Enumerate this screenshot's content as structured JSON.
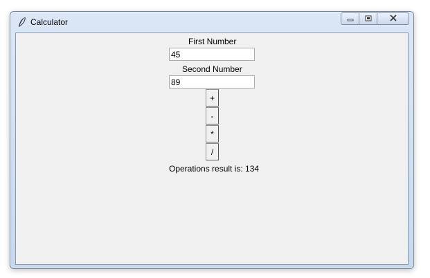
{
  "window": {
    "title": "Calculator"
  },
  "form": {
    "first_label": "First Number",
    "first_value": "45",
    "second_label": "Second Number",
    "second_value": "89"
  },
  "buttons": {
    "add": "+",
    "subtract": "-",
    "multiply": "*",
    "divide": "/"
  },
  "result": {
    "text": "Operations result is: 134"
  },
  "icons": {
    "app": "feather-icon",
    "minimize": "minimize-icon",
    "maximize": "maximize-icon",
    "close": "close-icon"
  }
}
